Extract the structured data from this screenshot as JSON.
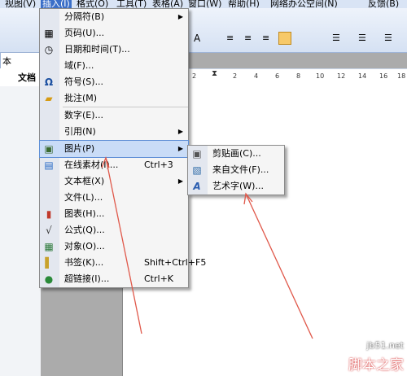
{
  "menubar": {
    "items": [
      {
        "label": "视图(V)",
        "selected": false
      },
      {
        "label": "插入(I)",
        "selected": true
      },
      {
        "label": "格式(O)",
        "selected": false
      },
      {
        "label": "工具(T)",
        "selected": false
      },
      {
        "label": "表格(A)",
        "selected": false
      },
      {
        "label": "窗口(W)",
        "selected": false
      },
      {
        "label": "帮助(H)",
        "selected": false
      },
      {
        "label": "网络办公空间(N)",
        "selected": false
      },
      {
        "label": "反馈(B)",
        "selected": false
      }
    ]
  },
  "sidebar": {
    "text_label": "本",
    "tab_label": "文档"
  },
  "ruler": {
    "ticks": [
      "2",
      "2",
      "4",
      "6",
      "8",
      "10",
      "12",
      "14",
      "16",
      "18"
    ]
  },
  "insert_menu": {
    "items": [
      {
        "label": "分隔符(B)",
        "shortcut": "",
        "submenu": true,
        "icon": "",
        "highlight": false
      },
      {
        "label": "页码(U)...",
        "shortcut": "",
        "submenu": false,
        "icon": "page-number-icon",
        "highlight": false
      },
      {
        "label": "日期和时间(T)...",
        "shortcut": "",
        "submenu": false,
        "icon": "date-time-icon",
        "highlight": false
      },
      {
        "label": "域(F)...",
        "shortcut": "",
        "submenu": false,
        "icon": "",
        "highlight": false
      },
      {
        "label": "符号(S)...",
        "shortcut": "",
        "submenu": false,
        "icon": "omega-icon",
        "highlight": false
      },
      {
        "label": "批注(M)",
        "shortcut": "",
        "submenu": false,
        "icon": "comment-icon",
        "highlight": false
      },
      {
        "label": "数字(E)...",
        "shortcut": "",
        "submenu": false,
        "icon": "",
        "highlight": false
      },
      {
        "label": "引用(N)",
        "shortcut": "",
        "submenu": true,
        "icon": "",
        "highlight": false
      },
      {
        "label": "图片(P)",
        "shortcut": "",
        "submenu": true,
        "icon": "picture-icon",
        "highlight": true
      },
      {
        "label": "在线素材(I)...",
        "shortcut": "Ctrl+3",
        "submenu": false,
        "icon": "online-material-icon",
        "highlight": false
      },
      {
        "label": "文本框(X)",
        "shortcut": "",
        "submenu": true,
        "icon": "",
        "highlight": false
      },
      {
        "label": "文件(L)...",
        "shortcut": "",
        "submenu": false,
        "icon": "",
        "highlight": false
      },
      {
        "label": "图表(H)...",
        "shortcut": "",
        "submenu": false,
        "icon": "chart-icon",
        "highlight": false
      },
      {
        "label": "公式(Q)...",
        "shortcut": "",
        "submenu": false,
        "icon": "formula-icon",
        "highlight": false
      },
      {
        "label": "对象(O)...",
        "shortcut": "",
        "submenu": false,
        "icon": "object-icon",
        "highlight": false
      },
      {
        "label": "书签(K)...",
        "shortcut": "Shift+Ctrl+F5",
        "submenu": false,
        "icon": "bookmark-icon",
        "highlight": false
      },
      {
        "label": "超链接(I)...",
        "shortcut": "Ctrl+K",
        "submenu": false,
        "icon": "hyperlink-icon",
        "highlight": false
      }
    ]
  },
  "picture_submenu": {
    "items": [
      {
        "label": "剪贴画(C)...",
        "icon": "clipart-icon"
      },
      {
        "label": "来自文件(F)...",
        "icon": "from-file-icon"
      },
      {
        "label": "艺术字(W)...",
        "icon": "wordart-icon"
      }
    ]
  },
  "watermark": {
    "site": "jb51.net",
    "name": "脚本之家"
  },
  "colors": {
    "highlight": "#c9dcf7",
    "arrow": "#e0584a"
  }
}
